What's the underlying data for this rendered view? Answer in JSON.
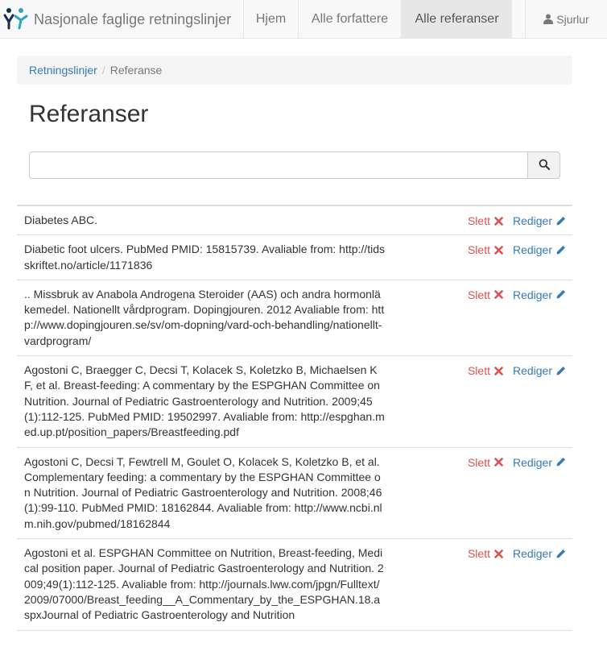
{
  "app": {
    "brand": "Nasjonale faglige retningslinjer",
    "nav": [
      {
        "label": "Hjem",
        "active": false
      },
      {
        "label": "Alle forfattere",
        "active": false
      },
      {
        "label": "Alle referanser",
        "active": true
      }
    ],
    "user": "Sjurlur"
  },
  "breadcrumb": {
    "root": "Retningslinjer",
    "current": "Referanse"
  },
  "page": {
    "title": "Referanser"
  },
  "search": {
    "value": "",
    "placeholder": "",
    "icon": "search-icon"
  },
  "actions": {
    "delete_label": "Slett",
    "edit_label": "Rediger"
  },
  "colors": {
    "danger": "#d9534f",
    "link": "#337ab7",
    "navbar_bg": "#f8f8f8",
    "active_nav_bg": "#e7e7e7"
  },
  "references": [
    "Diabetes ABC.",
    "Diabetic foot ulcers. PubMed PMID: 15815739. Avaliable from: http://tidsskriftet.no/article/1171836",
    ".. Missbruk av Anabola Androgena Steroider (AAS) och andra hormonläkemedel. Nationellt vårdprogram. Dopingjouren. 2012 Avaliable from: http://www.dopingjouren.se/sv/om-dopning/vard-och-behandling/nationellt-vardprogram/",
    "Agostoni C, Braegger C, Decsi T, Kolacek S, Koletzko B, Michaelsen KF, et al. Breast-feeding: A commentary by the ESPGHAN Committee on Nutrition. Journal of Pediatric Gastroenterology and Nutrition. 2009;45(1):112-125. PubMed PMID: 19502997. Avaliable from: http://espghan.med.up.pt/position_papers/Breastfeeding.pdf",
    "Agostoni C, Decsi T, Fewtrell M, Goulet O, Kolacek S, Koletzko B, et al. Complementary feeding: a commentary by the ESPGHAN Committee on Nutrition. Journal of Pediatric Gastroenterology and Nutrition. 2008;46(1):99-110. PubMed PMID: 18162844. Avaliable from: http://www.ncbi.nlm.nih.gov/pubmed/18162844",
    "Agostoni et al. ESPGHAN Committee on Nutrition, Breast-feeding, Medical position paper. Journal of Pediatric Gastroenterology and Nutrition. 2009;49(1):112-125. Avaliable from: http://journals.lww.com/jpgn/Fulltext/2009/07000/Breast_feeding__A_Commentary_by_the_ESPGHAN.18.aspxJournal of Pediatric Gastroenterology and Nutrition"
  ]
}
